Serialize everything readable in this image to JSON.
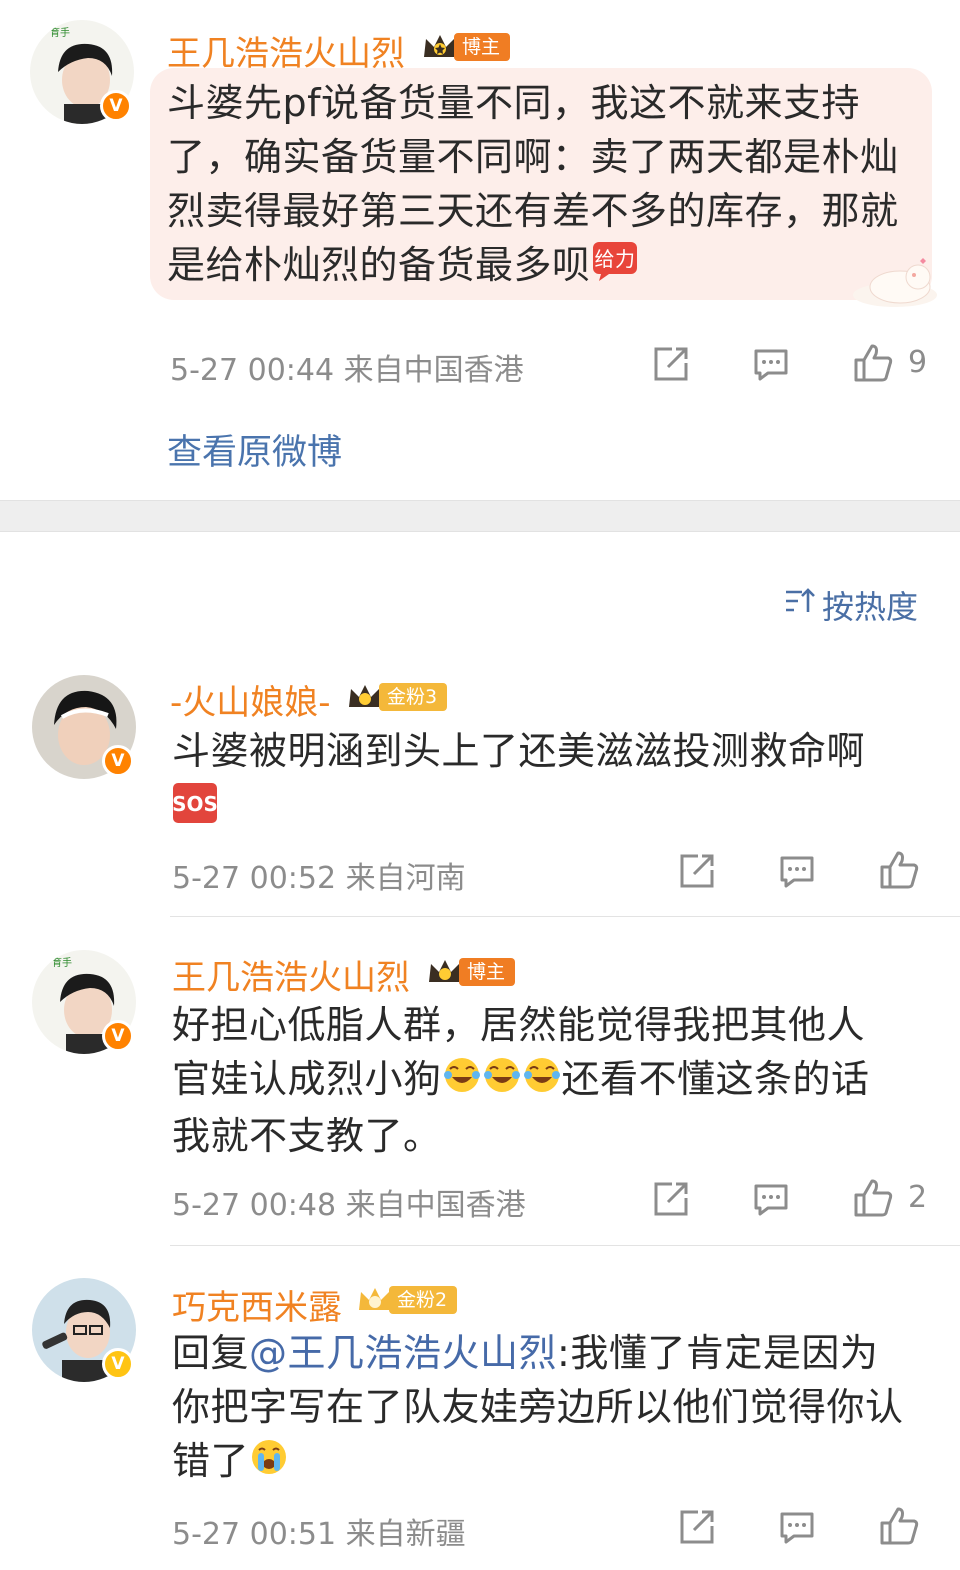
{
  "post": {
    "author": "王几浩浩火山烈",
    "badge": "博主",
    "text": "斗婆先pf说备货量不同，我这不就来支持了，确实备货量不同啊：卖了两天都是朴灿烈卖得最好第三天还有差不多的库存，那就是给朴灿烈的备货最多呗",
    "emoji_label": "给力",
    "meta": "5-27 00:44  来自中国香港",
    "like_count": "9",
    "view_original": "查看原微博"
  },
  "sort_label": "按热度",
  "comments": [
    {
      "author": "-火山娘娘-",
      "badge": "金粉3",
      "text": "斗婆被明涵到头上了还美滋滋投测救命啊",
      "meta": "5-27 00:52  来自河南",
      "like_count": ""
    },
    {
      "author": "王几浩浩火山烈",
      "badge": "博主",
      "text_part1": "好担心低脂人群，居然能觉得我把其他人官娃认成烈小狗",
      "text_part2": "还看不懂这条的话我就不支教了。",
      "meta": "5-27 00:48  来自中国香港",
      "like_count": "2"
    },
    {
      "author": "巧克西米露",
      "badge": "金粉2",
      "reply_prefix": "回复",
      "mention": "@王几浩浩火山烈",
      "text": ":我懂了肯定是因为你把字写在了队友娃旁边所以他们觉得你认错了",
      "meta": "5-27 00:51  来自新疆",
      "like_count": ""
    }
  ],
  "colors": {
    "name": "#f08222",
    "link": "#4a74ad",
    "meta": "#8c8c8c",
    "bubble": "#fdeeea",
    "host_badge": "#f07d23",
    "fan_badge": "#f4b83a"
  },
  "icons": [
    "share-icon",
    "comment-icon",
    "like-icon",
    "verified-icon",
    "crown-icon",
    "sort-icon"
  ]
}
